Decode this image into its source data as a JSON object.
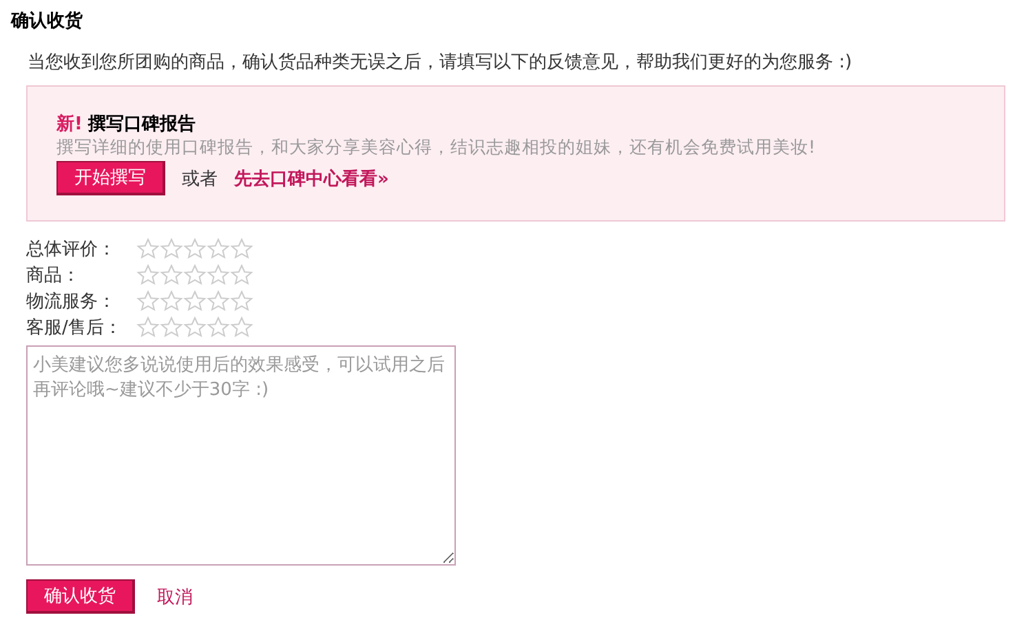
{
  "title": "确认收货",
  "intro": "当您收到您所团购的商品，确认货品种类无误之后，请填写以下的反馈意见，帮助我们更好的为您服务 :)",
  "promo": {
    "badge": "新!",
    "heading": "撰写口碑报告",
    "description": "撰写详细的使用口碑报告，和大家分享美容心得，结识志趣相投的姐妹，还有机会免费试用美妆!",
    "button": "开始撰写",
    "separator": "或者",
    "link": "先去口碑中心看看»"
  },
  "ratings": [
    {
      "label": "总体评价：",
      "stars": 0
    },
    {
      "label": "商品：",
      "stars": 0
    },
    {
      "label": "物流服务：",
      "stars": 0
    },
    {
      "label": "客服/售后：",
      "stars": 0
    }
  ],
  "comment": {
    "placeholder": "小美建议您多说说使用后的效果感受，可以试用之后再评论哦~建议不少于30字 :)"
  },
  "submit": "确认收货",
  "cancel": "取消"
}
